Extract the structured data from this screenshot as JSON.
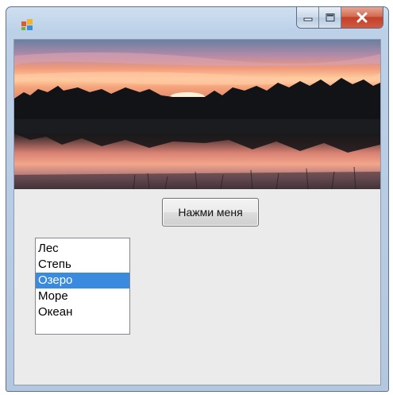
{
  "window": {
    "controls": {
      "minimize_icon": "minimize-icon",
      "maximize_icon": "maximize-icon",
      "close_icon": "close-icon"
    }
  },
  "main": {
    "image": "sunset-lake-photo",
    "button_label": "Нажми меня",
    "listbox": {
      "items": [
        "Лес",
        "Степь",
        "Озеро",
        "Море",
        "Океан"
      ],
      "selected": "Озеро"
    }
  },
  "colors": {
    "selection": "#3a8be0",
    "close_button": "#c8452d",
    "client_background": "#ebebeb"
  }
}
